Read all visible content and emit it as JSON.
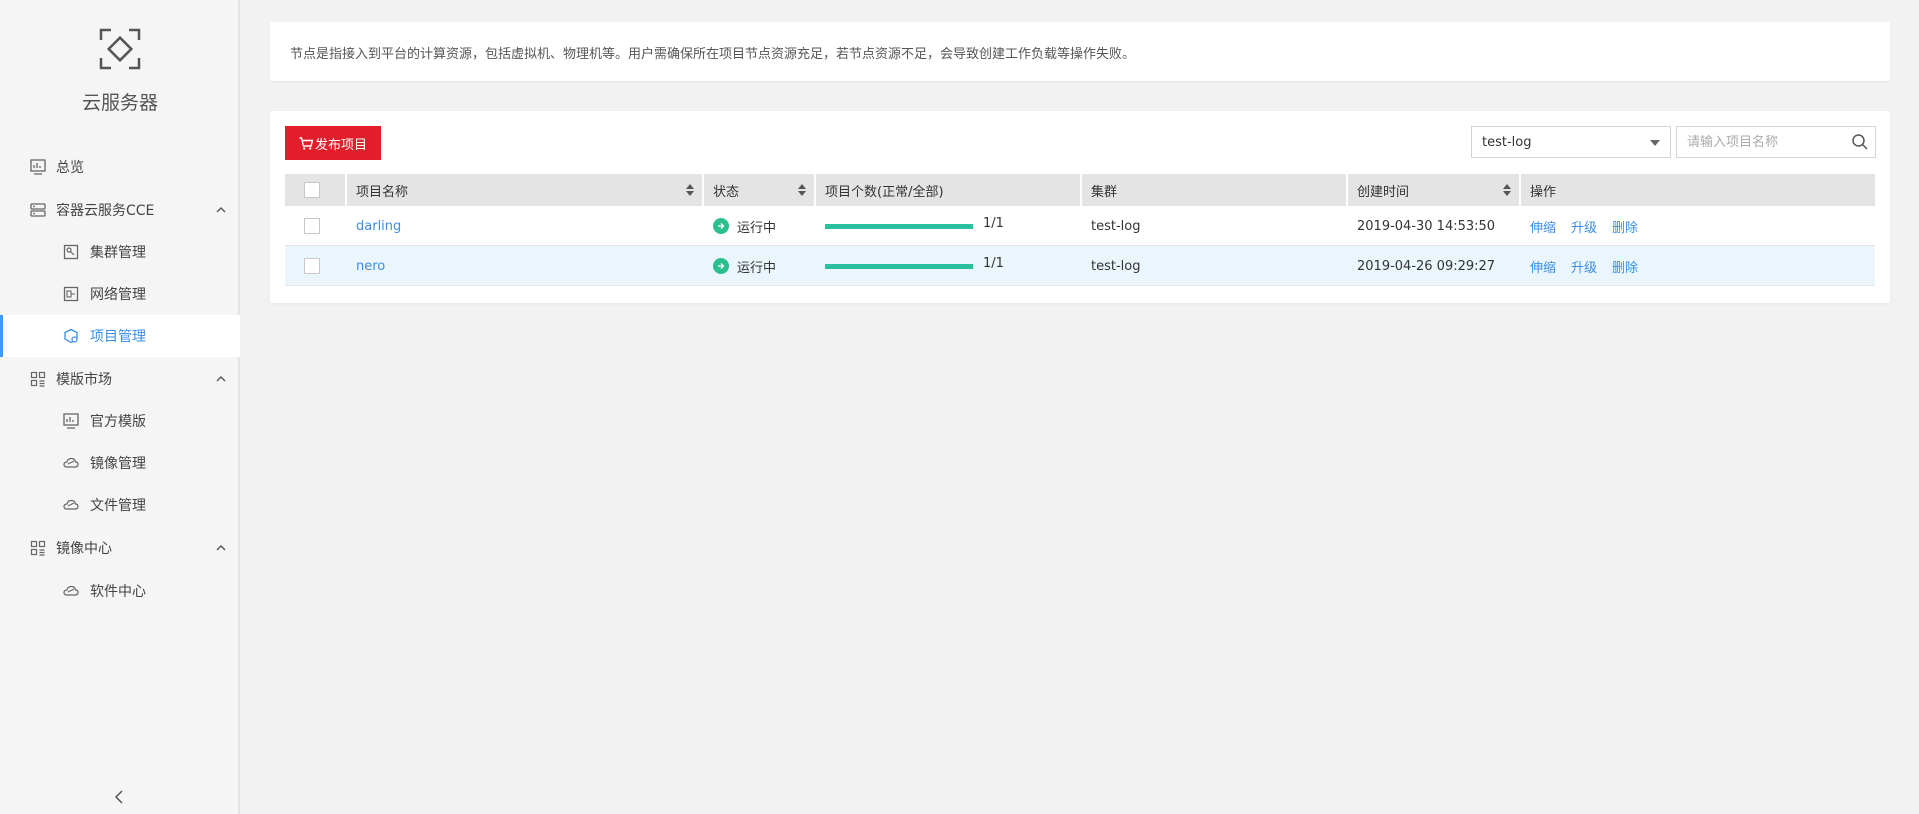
{
  "sidebar": {
    "title": "云服务器",
    "items": [
      {
        "label": "总览",
        "icon": "dashboard-icon"
      },
      {
        "label": "容器云服务CCE",
        "icon": "server-icon",
        "expanded": true
      },
      {
        "label": "集群管理",
        "icon": "cluster-icon"
      },
      {
        "label": "网络管理",
        "icon": "network-icon"
      },
      {
        "label": "项目管理",
        "icon": "project-icon",
        "active": true
      },
      {
        "label": "模版市场",
        "icon": "grid-icon",
        "expanded": true
      },
      {
        "label": "官方模版",
        "icon": "dashboard-icon"
      },
      {
        "label": "镜像管理",
        "icon": "cloud-icon"
      },
      {
        "label": "文件管理",
        "icon": "cloud-icon"
      },
      {
        "label": "镜像中心",
        "icon": "grid-icon",
        "expanded": true
      },
      {
        "label": "软件中心",
        "icon": "cloud-icon"
      }
    ]
  },
  "notice": "节点是指接入到平台的计算资源，包括虚拟机、物理机等。用户需确保所在项目节点资源充足，若节点资源不足，会导致创建工作负载等操作失败。",
  "toolbar": {
    "publish_label": "发布项目",
    "cluster_select": "test-log",
    "search_placeholder": "请输入项目名称"
  },
  "table": {
    "headers": [
      "项目名称",
      "状态",
      "项目个数(正常/全部)",
      "集群",
      "创建时间",
      "操作"
    ],
    "rows": [
      {
        "name": "darling",
        "status": "运行中",
        "count": "1/1",
        "progress": 1.0,
        "cluster": "test-log",
        "created": "2019-04-30 14:53:50",
        "ops": [
          "伸缩",
          "升级",
          "删除"
        ]
      },
      {
        "name": "nero",
        "status": "运行中",
        "count": "1/1",
        "progress": 1.0,
        "cluster": "test-log",
        "created": "2019-04-26 09:29:27",
        "ops": [
          "伸缩",
          "升级",
          "删除"
        ]
      }
    ]
  },
  "colors": {
    "accent": "#3a8ee6",
    "publish": "#e31e2b",
    "status": "#2bbf8f",
    "row_highlight": "#eaf5fc"
  }
}
